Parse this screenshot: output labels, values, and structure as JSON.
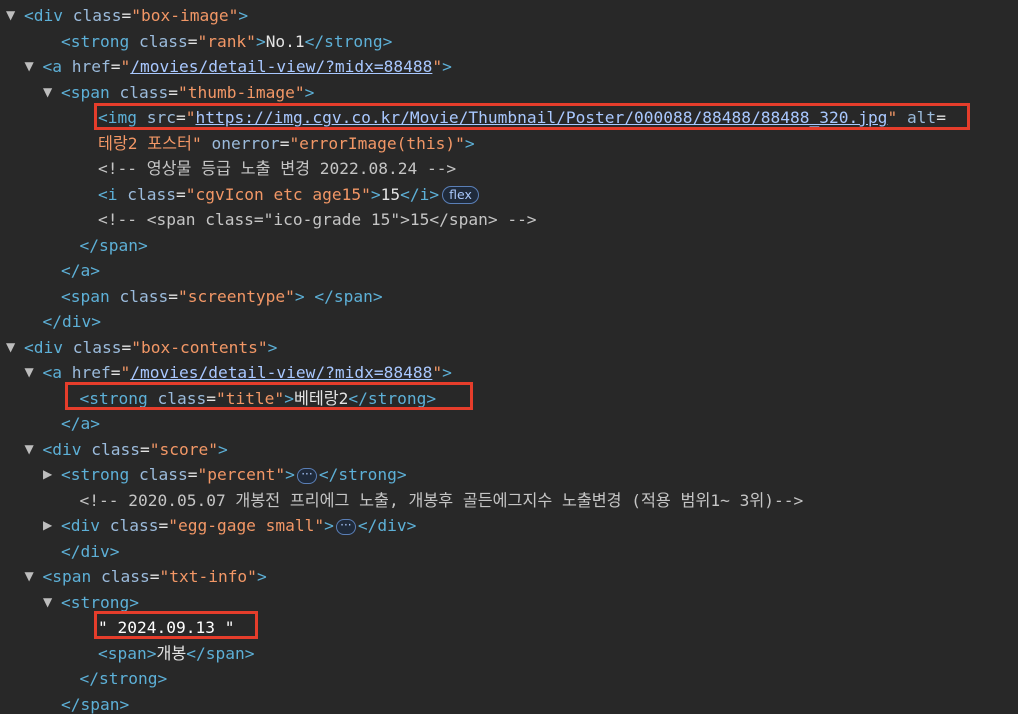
{
  "colors": {
    "background": "#282828",
    "tag": "#5db0d7",
    "attr_name": "#9bbbdc",
    "attr_value": "#f29766",
    "link": "#a9c8ff",
    "text": "#e3e3e3",
    "highlight": "#e53d2b"
  },
  "lines": [
    {
      "indent": 1,
      "arrow": "▼",
      "parts": [
        [
          "tag",
          "<div "
        ],
        [
          "attr-name",
          "class"
        ],
        [
          "attr-eq",
          "="
        ],
        [
          "attr-value",
          "\"box-image\""
        ],
        [
          "tag",
          ">"
        ]
      ]
    },
    {
      "indent": 3,
      "arrow": "",
      "parts": [
        [
          "tag",
          "<strong "
        ],
        [
          "attr-name",
          "class"
        ],
        [
          "attr-eq",
          "="
        ],
        [
          "attr-value",
          "\"rank\""
        ],
        [
          "tag",
          ">"
        ],
        [
          "text",
          "No.1"
        ],
        [
          "tag",
          "</strong>"
        ]
      ]
    },
    {
      "indent": 2,
      "arrow": "▼",
      "parts": [
        [
          "tag",
          "<a "
        ],
        [
          "attr-name",
          "href"
        ],
        [
          "attr-eq",
          "="
        ],
        [
          "attr-value",
          "\""
        ],
        [
          "attr-link",
          "/movies/detail-view/?midx=88488"
        ],
        [
          "attr-value",
          "\""
        ],
        [
          "tag",
          ">"
        ]
      ]
    },
    {
      "indent": 3,
      "arrow": "▼",
      "parts": [
        [
          "tag",
          "<span "
        ],
        [
          "attr-name",
          "class"
        ],
        [
          "attr-eq",
          "="
        ],
        [
          "attr-value",
          "\"thumb-image\""
        ],
        [
          "tag",
          ">"
        ]
      ]
    },
    {
      "indent": 5,
      "arrow": "",
      "parts": [
        [
          "tag",
          "<img "
        ],
        [
          "attr-name",
          "src"
        ],
        [
          "attr-eq",
          "="
        ],
        [
          "attr-value",
          "\""
        ],
        [
          "attr-link",
          "https://img.cgv.co.kr/Movie/Thumbnail/Poster/000088/88488/88488_320.jpg"
        ],
        [
          "attr-value",
          "\""
        ],
        [
          "text",
          " "
        ],
        [
          "attr-name",
          "alt"
        ],
        [
          "attr-eq",
          "="
        ]
      ]
    },
    {
      "indent": 5,
      "arrow": "",
      "parts": [
        [
          "attr-value",
          "테랑2 포스터\""
        ],
        [
          "text",
          " "
        ],
        [
          "attr-name",
          "onerror"
        ],
        [
          "attr-eq",
          "="
        ],
        [
          "attr-value",
          "\"errorImage(this)\""
        ],
        [
          "tag",
          ">"
        ]
      ]
    },
    {
      "indent": 5,
      "arrow": "",
      "parts": [
        [
          "comment",
          "<!-- 영상물 등급 노출 변경 2022.08.24 -->"
        ]
      ]
    },
    {
      "indent": 5,
      "arrow": "",
      "parts": [
        [
          "tag",
          "<i "
        ],
        [
          "attr-name",
          "class"
        ],
        [
          "attr-eq",
          "="
        ],
        [
          "attr-value",
          "\"cgvIcon etc age15\""
        ],
        [
          "tag",
          ">"
        ],
        [
          "text",
          "15"
        ],
        [
          "tag",
          "</i>"
        ]
      ],
      "badge": "flex"
    },
    {
      "indent": 5,
      "arrow": "",
      "parts": [
        [
          "comment",
          "<!-- <span class=\"ico-grade 15\">15</span> -->"
        ]
      ]
    },
    {
      "indent": 4,
      "arrow": "",
      "parts": [
        [
          "tag",
          "</span>"
        ]
      ]
    },
    {
      "indent": 3,
      "arrow": "",
      "parts": [
        [
          "tag",
          "</a>"
        ]
      ]
    },
    {
      "indent": 3,
      "arrow": "",
      "parts": [
        [
          "tag",
          "<span "
        ],
        [
          "attr-name",
          "class"
        ],
        [
          "attr-eq",
          "="
        ],
        [
          "attr-value",
          "\"screentype\""
        ],
        [
          "tag",
          ">"
        ],
        [
          "text",
          " "
        ],
        [
          "tag",
          "</span>"
        ]
      ]
    },
    {
      "indent": 2,
      "arrow": "",
      "parts": [
        [
          "tag",
          "</div>"
        ]
      ]
    },
    {
      "indent": 1,
      "arrow": "▼",
      "parts": [
        [
          "tag",
          "<div "
        ],
        [
          "attr-name",
          "class"
        ],
        [
          "attr-eq",
          "="
        ],
        [
          "attr-value",
          "\"box-contents\""
        ],
        [
          "tag",
          ">"
        ]
      ]
    },
    {
      "indent": 2,
      "arrow": "▼",
      "parts": [
        [
          "tag",
          "<a "
        ],
        [
          "attr-name",
          "href"
        ],
        [
          "attr-eq",
          "="
        ],
        [
          "attr-value",
          "\""
        ],
        [
          "attr-link",
          "/movies/detail-view/?midx=88488"
        ],
        [
          "attr-value",
          "\""
        ],
        [
          "tag",
          ">"
        ]
      ]
    },
    {
      "indent": 4,
      "arrow": "",
      "parts": [
        [
          "tag",
          "<strong "
        ],
        [
          "attr-name",
          "class"
        ],
        [
          "attr-eq",
          "="
        ],
        [
          "attr-value",
          "\"title\""
        ],
        [
          "tag",
          ">"
        ],
        [
          "text",
          "베테랑2"
        ],
        [
          "tag",
          "</strong>"
        ]
      ]
    },
    {
      "indent": 3,
      "arrow": "",
      "parts": [
        [
          "tag",
          "</a>"
        ]
      ]
    },
    {
      "indent": 2,
      "arrow": "▼",
      "parts": [
        [
          "tag",
          "<div "
        ],
        [
          "attr-name",
          "class"
        ],
        [
          "attr-eq",
          "="
        ],
        [
          "attr-value",
          "\"score\""
        ],
        [
          "tag",
          ">"
        ]
      ]
    },
    {
      "indent": 3,
      "arrow": "▶",
      "parts": [
        [
          "tag",
          "<strong "
        ],
        [
          "attr-name",
          "class"
        ],
        [
          "attr-eq",
          "="
        ],
        [
          "attr-value",
          "\"percent\""
        ],
        [
          "tag",
          ">"
        ]
      ],
      "ellipsis": "···",
      "tail": [
        [
          "tag",
          "</strong>"
        ]
      ]
    },
    {
      "indent": 4,
      "arrow": "",
      "parts": [
        [
          "comment",
          "<!-- 2020.05.07 개봉전 프리에그 노출, 개봉후 골든에그지수 노출변경 (적용 범위1~ 3위)-->"
        ]
      ]
    },
    {
      "indent": 3,
      "arrow": "▶",
      "parts": [
        [
          "tag",
          "<div "
        ],
        [
          "attr-name",
          "class"
        ],
        [
          "attr-eq",
          "="
        ],
        [
          "attr-value",
          "\"egg-gage small\""
        ],
        [
          "tag",
          ">"
        ]
      ],
      "ellipsis": "···",
      "tail": [
        [
          "tag",
          "</div>"
        ]
      ]
    },
    {
      "indent": 3,
      "arrow": "",
      "parts": [
        [
          "tag",
          "</div>"
        ]
      ]
    },
    {
      "indent": 2,
      "arrow": "▼",
      "parts": [
        [
          "tag",
          "<span "
        ],
        [
          "attr-name",
          "class"
        ],
        [
          "attr-eq",
          "="
        ],
        [
          "attr-value",
          "\"txt-info\""
        ],
        [
          "tag",
          ">"
        ]
      ]
    },
    {
      "indent": 3,
      "arrow": "▼",
      "parts": [
        [
          "tag",
          "<strong>"
        ]
      ]
    },
    {
      "indent": 5,
      "arrow": "",
      "parts": [
        [
          "quote-text",
          "\" 2024.09.13 \""
        ]
      ]
    },
    {
      "indent": 5,
      "arrow": "",
      "parts": [
        [
          "tag",
          "<span>"
        ],
        [
          "text",
          "개봉"
        ],
        [
          "tag",
          "</span>"
        ]
      ]
    },
    {
      "indent": 4,
      "arrow": "",
      "parts": [
        [
          "tag",
          "</strong>"
        ]
      ]
    },
    {
      "indent": 3,
      "arrow": "",
      "parts": [
        [
          "tag",
          "</span>"
        ]
      ]
    }
  ]
}
